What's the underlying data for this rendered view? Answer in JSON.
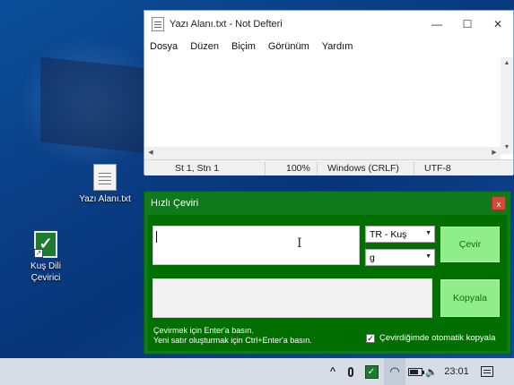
{
  "desktop": {
    "icons": [
      {
        "label": "Yazı Alanı.txt",
        "icon": "text-file-icon"
      },
      {
        "label": "Kuş Dili\nÇevirici",
        "icon": "kus-dili-app-icon"
      }
    ]
  },
  "notepad": {
    "title": "Yazı Alanı.txt - Not Defteri",
    "menu": [
      "Dosya",
      "Düzen",
      "Biçim",
      "Görünüm",
      "Yardım"
    ],
    "window_buttons": {
      "minimize": "—",
      "maximize": "☐",
      "close": "✕"
    },
    "status": {
      "position": "St 1, Stn 1",
      "zoom": "100%",
      "line_ending": "Windows (CRLF)",
      "encoding": "UTF-8"
    }
  },
  "translator": {
    "title": "Hızlı Çeviri",
    "close": "x",
    "input_value": "",
    "language": "TR - Kuş",
    "variant": "g",
    "translate_button": "Çevir",
    "output_value": "",
    "copy_button": "Kopyala",
    "hint_line1": "Çevirmek için Enter'a basın.",
    "hint_line2": "Yeni satır oluşturmak için Ctrl+Enter'a basın.",
    "auto_copy": {
      "label": "Çevirdiğimde otomatik kopyala",
      "checked": true,
      "mark": "✓"
    }
  },
  "taskbar": {
    "clock": "23:01",
    "tray_icons": [
      "chevron-up-icon",
      "microphone-icon",
      "kus-tray-icon",
      "wifi-icon",
      "battery-icon",
      "volume-icon",
      "notification-icon"
    ],
    "chevron": "^",
    "volume": "🔈"
  },
  "colors": {
    "translator_bg": "#006f00",
    "translator_border": "#0e7a1a",
    "button_green": "#8fee8a",
    "close_red": "#d44a3a",
    "desktop_blue": "#0a3f86"
  }
}
